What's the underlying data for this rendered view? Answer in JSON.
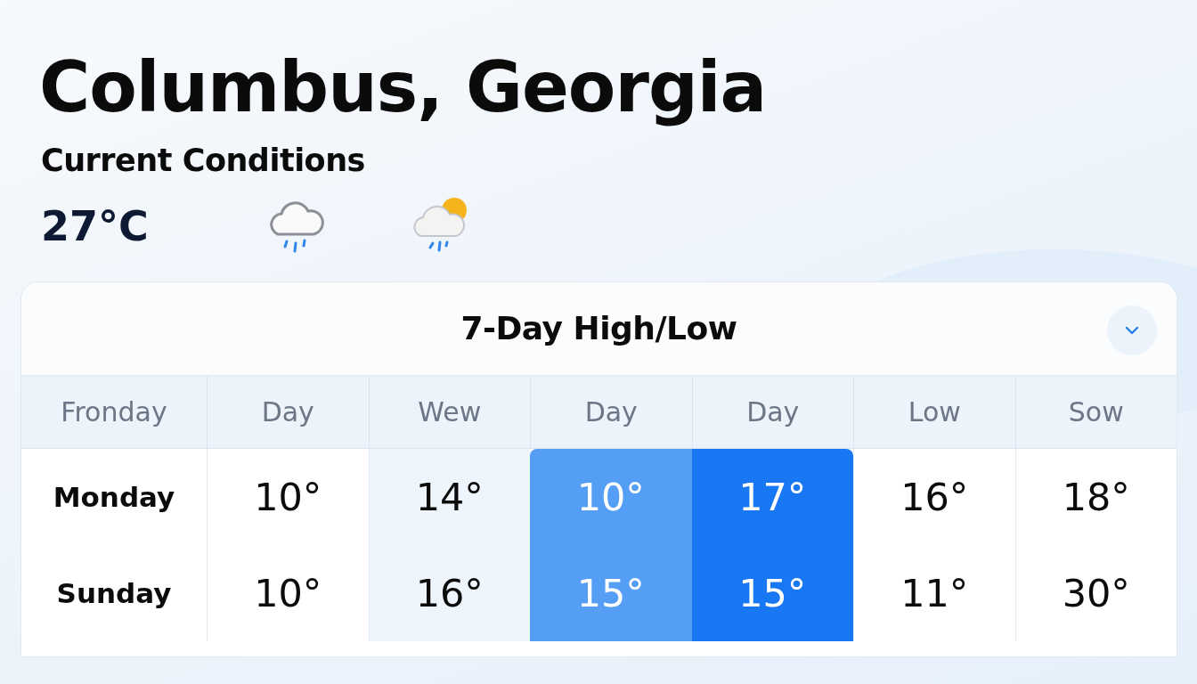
{
  "city": "Columbus, Georgia",
  "current": {
    "heading": "Current Conditions",
    "temperature": "27°C",
    "icons": [
      {
        "kind": "rain"
      },
      {
        "kind": "sun-rain"
      }
    ]
  },
  "forecast": {
    "title": "7-Day High/Low",
    "collapse_button": {
      "expanded": true
    },
    "columns": [
      {
        "label": "Fronday",
        "kind": "plain"
      },
      {
        "label": "Day",
        "kind": "plain"
      },
      {
        "label": "Wew",
        "kind": "tinted"
      },
      {
        "label": "Day",
        "kind": "highlighted"
      },
      {
        "label": "Day",
        "kind": "accent"
      },
      {
        "label": "Low",
        "kind": "plain"
      },
      {
        "label": "Sow",
        "kind": "plain"
      }
    ],
    "rows": [
      {
        "day": "Monday",
        "values": [
          "10°",
          "14°",
          "10°",
          "17°",
          "16°",
          "18°"
        ]
      },
      {
        "day": "Sunday",
        "values": [
          "10°",
          "16°",
          "15°",
          "15°",
          "11°",
          "30°"
        ]
      }
    ]
  }
}
